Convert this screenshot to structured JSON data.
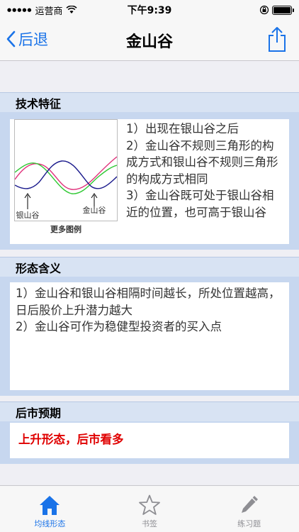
{
  "status_bar": {
    "carrier": "运营商",
    "time": "下午9:39"
  },
  "nav": {
    "back_label": "后退",
    "title": "金山谷"
  },
  "sections": {
    "features": {
      "header": "技术特征",
      "chart_labels": [
        "银山谷",
        "金山谷"
      ],
      "more_link": "更多图例",
      "text": "1）出现在银山谷之后\n2）金山谷不规则三角形的构成方式和银山谷不规则三角形的构成方式相同\n3）金山谷既可处于银山谷相近的位置，也可高于银山谷"
    },
    "meaning": {
      "header": "形态含义",
      "text": "1）金山谷和银山谷相隔时间越长，所处位置越高，日后股价上升潜力越大\n2）金山谷可作为稳健型投资者的买入点"
    },
    "outlook": {
      "header": "后市预期",
      "text": "上升形态，后市看多"
    }
  },
  "tabs": [
    {
      "label": "均线形态",
      "icon": "home-icon",
      "active": true
    },
    {
      "label": "书签",
      "icon": "star-icon",
      "active": false
    },
    {
      "label": "练习题",
      "icon": "pencil-icon",
      "active": false
    }
  ],
  "colors": {
    "accent": "#1a73e8",
    "outlook_text": "#e00000",
    "section_bg": "#c7d7ef",
    "line_red": "#e0307a",
    "line_green": "#2ec832",
    "line_navy": "#1a1a8c"
  }
}
